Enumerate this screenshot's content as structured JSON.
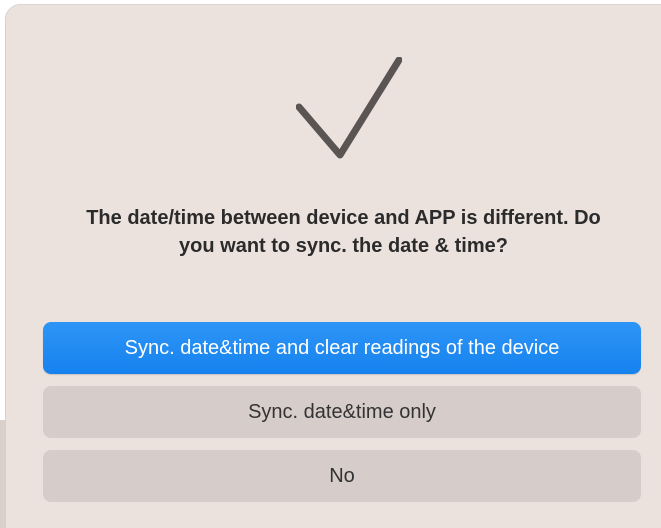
{
  "dialog": {
    "icon": "checkmark-icon",
    "message": "The date/time between device and APP is different. Do you want to sync. the date & time?",
    "buttons": {
      "sync_clear": "Sync. date&time and clear readings of the device",
      "sync_only": "Sync. date&time only",
      "no": "No"
    }
  },
  "colors": {
    "dialog_background": "#ebe2de",
    "primary_button": "#1a86f0",
    "secondary_button": "#d6cdca",
    "checkmark": "#5a5452"
  }
}
